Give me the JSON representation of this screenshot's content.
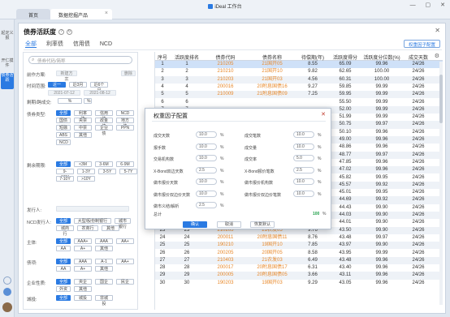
{
  "window": {
    "title": "iDeal 工作台",
    "controls": [
      "—",
      "▢",
      "✕"
    ]
  },
  "tabs": {
    "home": "首页",
    "active": "数据挖掘产品"
  },
  "sidebar": [
    {
      "label": "起定义报",
      "selected": false
    },
    {
      "label": "开仁摸件",
      "selected": false
    },
    {
      "label": "债券活跃",
      "selected": true
    }
  ],
  "panel": {
    "title": "债券活跃度",
    "subtabs": [
      "全部",
      "利率债",
      "信用债",
      "NCD"
    ],
    "top_button": "权重因子配置"
  },
  "filters": {
    "search_placeholder": "债券代码/简称",
    "sections": [
      {
        "label": "前作方案:",
        "chips": [
          {
            "t": "新建方案",
            "g": true
          },
          {
            "t": "删除",
            "g": true
          }
        ]
      },
      {
        "label": "时间范围:",
        "chips": [
          {
            "t": "近一月",
            "on": true
          },
          {
            "t": "近3月"
          },
          {
            "t": "近6个月"
          }
        ]
      },
      {
        "label": "",
        "chips": [
          {
            "t": "2021-07-12",
            "g": true
          },
          {
            "t": "2021-08-12",
            "g": true
          }
        ]
      },
      {
        "label": "剩期/跨成交:",
        "chips": [
          {
            "t": "%"
          },
          {
            "t": "%"
          }
        ]
      },
      {
        "label": "债券类型:",
        "chips": [
          {
            "t": "全部",
            "on": true
          },
          {
            "t": "利率债"
          },
          {
            "t": "信用债"
          },
          {
            "t": "NCD"
          },
          {
            "t": "国债"
          },
          {
            "t": "央票"
          },
          {
            "t": "政金债"
          },
          {
            "t": "地方债"
          },
          {
            "t": "短融"
          },
          {
            "t": "中票"
          },
          {
            "t": "企业债"
          },
          {
            "t": "PPN"
          },
          {
            "t": "ABS"
          },
          {
            "t": "其他"
          },
          {
            "t": "NCD"
          }
        ]
      },
      {
        "label": "剩余期限:",
        "chips": [
          {
            "t": "全部",
            "on": true
          },
          {
            "t": "<3M"
          },
          {
            "t": "3-6M"
          },
          {
            "t": "6-9M"
          },
          {
            "t": "9-12M"
          },
          {
            "t": "1-3Y"
          },
          {
            "t": "3-5Y"
          },
          {
            "t": "5-7Y"
          },
          {
            "t": "7-10Y"
          },
          {
            "t": ">10Y"
          }
        ]
      },
      {
        "label": "发行人:",
        "chips": [
          {
            "t": "",
            "g": true
          }
        ]
      },
      {
        "label": "NCD发行人:",
        "chips": [
          {
            "t": "全部",
            "on": true
          },
          {
            "t": "大型/股份制银行"
          },
          {
            "t": "城市银行"
          },
          {
            "t": "城商行"
          },
          {
            "t": "农商行"
          },
          {
            "t": "其他"
          }
        ]
      },
      {
        "label": "主体:",
        "chips": [
          {
            "t": "全部",
            "on": true
          },
          {
            "t": "AAA+"
          },
          {
            "t": "AAA"
          },
          {
            "t": "AA+"
          },
          {
            "t": "AA"
          },
          {
            "t": "A+"
          },
          {
            "t": "其他"
          }
        ]
      },
      {
        "label": "债项:",
        "chips": [
          {
            "t": "全部",
            "on": true
          },
          {
            "t": "AAA"
          },
          {
            "t": "A-1"
          },
          {
            "t": "AA+"
          },
          {
            "t": "AA"
          },
          {
            "t": "A+"
          },
          {
            "t": "其他"
          }
        ]
      },
      {
        "label": "企业性质:",
        "chips": [
          {
            "t": "全部",
            "on": true
          },
          {
            "t": "央企"
          },
          {
            "t": "国企"
          },
          {
            "t": "民企"
          },
          {
            "t": "外资"
          },
          {
            "t": "其他"
          }
        ]
      },
      {
        "label": "城投:",
        "chips": [
          {
            "t": "全部",
            "on": true
          },
          {
            "t": "城投"
          },
          {
            "t": "非城投"
          }
        ]
      }
    ]
  },
  "table": {
    "headers": [
      "序号",
      "活跃度排名",
      "债券代码",
      "债券名称",
      "待偿期(年)",
      "活跃度得分",
      "活跃度分位数(%)",
      "成交天数"
    ],
    "rows": [
      [
        "1",
        "1",
        "210205",
        "21国开05",
        "8.55",
        "65.09",
        "99.96",
        "24/26"
      ],
      [
        "2",
        "2",
        "210210",
        "21国开10",
        "9.82",
        "62.65",
        "100.00",
        "24/26"
      ],
      [
        "3",
        "3",
        "210203",
        "21国开03",
        "4.56",
        "60.31",
        "100.00",
        "24/26"
      ],
      [
        "4",
        "4",
        "200016",
        "20附息国债16",
        "9.27",
        "59.85",
        "99.99",
        "24/26"
      ],
      [
        "5",
        "5",
        "210009",
        "21附息国债09",
        "7.25",
        "59.95",
        "99.99",
        "24/26"
      ],
      [
        "6",
        "6",
        "",
        "",
        "",
        "55.50",
        "99.99",
        "24/26"
      ],
      [
        "7",
        "7",
        "",
        "",
        "",
        "52.00",
        "99.99",
        "24/26"
      ],
      [
        "8",
        "8",
        "",
        "",
        "",
        "51.99",
        "99.99",
        "24/26"
      ],
      [
        "9",
        "9",
        "",
        "",
        "",
        "50.75",
        "99.97",
        "24/26"
      ],
      [
        "10",
        "10",
        "",
        "",
        "",
        "50.10",
        "99.96",
        "24/26"
      ],
      [
        "11",
        "11",
        "",
        "",
        "",
        "49.00",
        "99.96",
        "24/26"
      ],
      [
        "12",
        "12",
        "",
        "",
        "",
        "48.86",
        "99.96",
        "24/26"
      ],
      [
        "13",
        "13",
        "",
        "",
        "",
        "48.77",
        "99.97",
        "24/26"
      ],
      [
        "14",
        "14",
        "",
        "",
        "",
        "47.85",
        "99.96",
        "24/26"
      ],
      [
        "15",
        "15",
        "",
        "",
        "",
        "47.02",
        "99.96",
        "24/26"
      ],
      [
        "16",
        "16",
        "",
        "",
        "",
        "45.82",
        "99.95",
        "24/26"
      ],
      [
        "17",
        "17",
        "",
        "",
        "",
        "45.57",
        "99.92",
        "24/26"
      ],
      [
        "18",
        "18",
        "",
        "",
        "",
        "45.01",
        "99.95",
        "24/26"
      ],
      [
        "19",
        "19",
        "",
        "",
        "",
        "44.69",
        "99.92",
        "24/26"
      ],
      [
        "20",
        "20",
        "",
        "",
        "",
        "44.43",
        "99.90",
        "24/26"
      ],
      [
        "21",
        "21",
        "",
        "",
        "",
        "44.03",
        "99.90",
        "24/26"
      ],
      [
        "22",
        "22",
        "210405",
        "21农发05",
        "9.78",
        "44.01",
        "99.90",
        "24/26"
      ],
      [
        "23",
        "23",
        "210205",
        "21农发05",
        "9.76",
        "43.50",
        "99.90",
        "24/26"
      ],
      [
        "24",
        "24",
        "200011",
        "20附息国债11",
        "8.76",
        "43.48",
        "99.97",
        "24/26"
      ],
      [
        "25",
        "25",
        "190210",
        "19国开10",
        "7.85",
        "43.97",
        "99.90",
        "24/26"
      ],
      [
        "26",
        "26",
        "200205",
        "20国开05",
        "8.58",
        "43.95",
        "99.99",
        "24/26"
      ],
      [
        "27",
        "27",
        "210403",
        "21农发03",
        "6.49",
        "43.48",
        "99.96",
        "24/26"
      ],
      [
        "28",
        "28",
        "200017",
        "20附息国债17",
        "6.31",
        "43.40",
        "99.96",
        "24/26"
      ],
      [
        "29",
        "29",
        "200005",
        "20附息国债05",
        "3.66",
        "43.11",
        "99.96",
        "24/26"
      ],
      [
        "30",
        "30",
        "190203",
        "19国开03",
        "9.29",
        "43.05",
        "99.96",
        "24/26"
      ]
    ]
  },
  "modal": {
    "title": "权重因子配置",
    "fields_left": [
      {
        "label": "成交天数",
        "value": "10.0"
      },
      {
        "label": "报手数",
        "value": "10.0"
      },
      {
        "label": "交易机构数",
        "value": "10.0"
      },
      {
        "label": "X-Bond双边天数",
        "value": "2.5"
      },
      {
        "label": "做市报价天数",
        "value": "10.0"
      },
      {
        "label": "做市报价双边价天数",
        "value": "10.0"
      },
      {
        "label": "做市义结/解析",
        "value": "2.5"
      }
    ],
    "fields_right": [
      {
        "label": "成交笔数",
        "value": "10.0"
      },
      {
        "label": "成交量",
        "value": "10.0"
      },
      {
        "label": "成交率",
        "value": "5.0"
      },
      {
        "label": "X-Bond报价笔数",
        "value": "2.5"
      },
      {
        "label": "做市报价机构数",
        "value": "10.0"
      },
      {
        "label": "做市报价双边价笔数",
        "value": "10.0"
      }
    ],
    "total_label": "总计",
    "total_value": "100",
    "pct": "%",
    "buttons": {
      "ok": "确认",
      "cancel": "取消",
      "reset": "恢复默认"
    }
  }
}
